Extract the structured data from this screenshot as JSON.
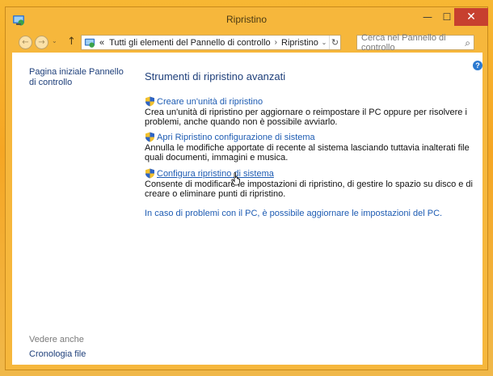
{
  "window": {
    "title": "Ripristino",
    "controls": {
      "minimize": "—",
      "maximize": "☐",
      "close": "✕"
    }
  },
  "toolbar": {
    "back": "←",
    "forward": "→",
    "recent": "⌄",
    "up": "↑",
    "address": {
      "overflow": "«",
      "segments": [
        "Tutti gli elementi del Pannello di controllo",
        "Ripristino"
      ],
      "separator": "›",
      "dropdown": "⌄",
      "refresh": "↻"
    },
    "search": {
      "placeholder": "Cerca nel Pannello di controllo",
      "icon": "⌕"
    }
  },
  "sidebar": {
    "home": "Pagina iniziale Pannello di controllo",
    "see_also": "Vedere anche",
    "history": "Cronologia file"
  },
  "help": "?",
  "main": {
    "title": "Strumenti di ripristino avanzati",
    "tasks": [
      {
        "label": "Creare un'unità di ripristino",
        "description": "Crea un'unità di ripristino per aggiornare o reimpostare il PC oppure per risolvere i problemi, anche quando non è possibile avviarlo."
      },
      {
        "label": "Apri Ripristino configurazione di sistema",
        "description": "Annulla le modifiche apportate di recente al sistema lasciando tuttavia inalterati file quali documenti, immagini e musica."
      },
      {
        "label": "Configura ripristino di sistema",
        "description": "Consente di modificare le impostazioni di ripristino, di gestire lo spazio su disco e di creare o eliminare punti di ripristino."
      }
    ],
    "bottom_link": "In caso di problemi con il PC, è possibile aggiornare le impostazioni del PC."
  },
  "colors": {
    "frame": "#f6b73c",
    "link": "#1e5cb3",
    "heading": "#1e3f7a",
    "close": "#c7402f"
  }
}
